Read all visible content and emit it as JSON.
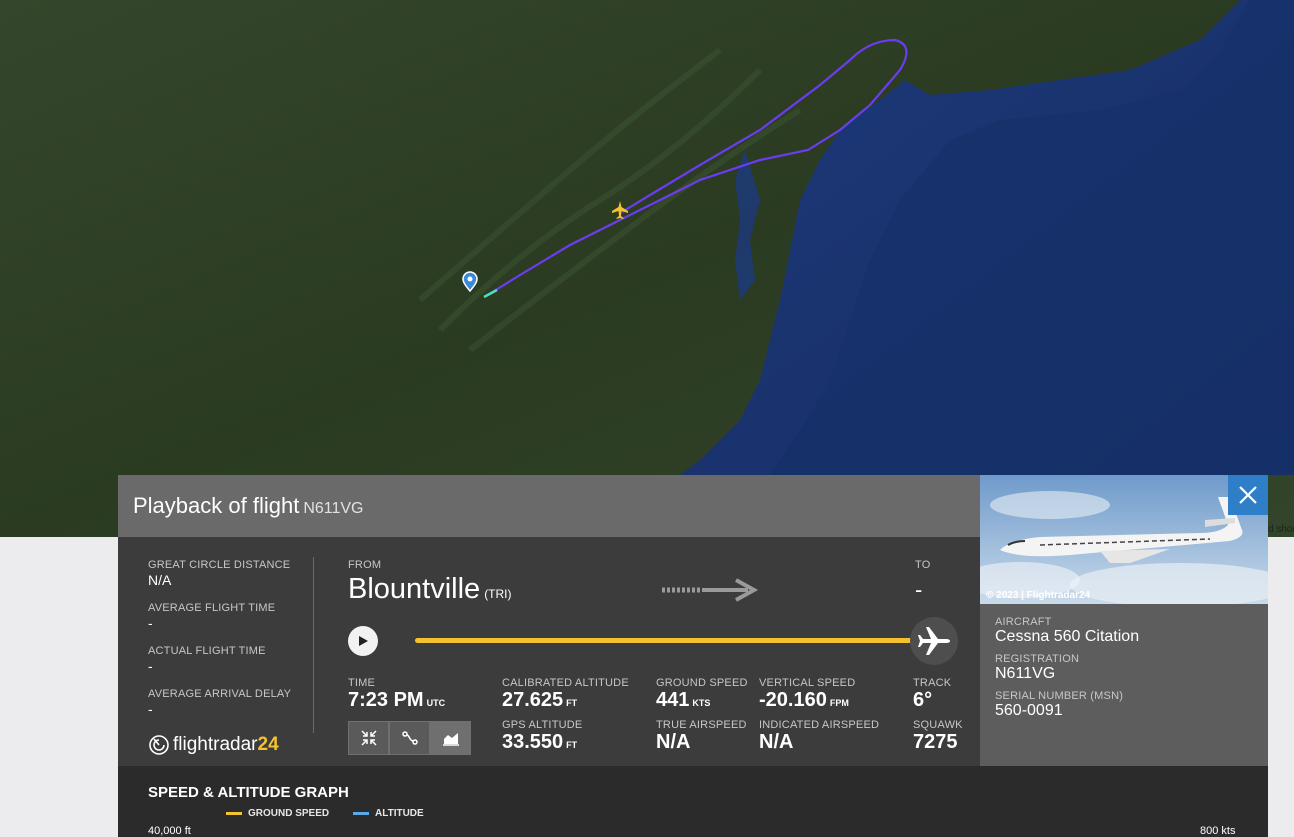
{
  "map": {
    "attribution": "d shor",
    "colors": {
      "flight_path": "#6b3cf0",
      "ocean": "#1e3d7c",
      "land": "#2d3f22",
      "aircraft": "#f3c22e",
      "origin_marker": "#3b8ad8"
    }
  },
  "panel": {
    "title": "Playback of flight",
    "registration": "N611VG",
    "close_icon": "close-icon"
  },
  "stats_left": {
    "great_circle_distance_label": "GREAT CIRCLE DISTANCE",
    "great_circle_distance": "N/A",
    "average_flight_time_label": "AVERAGE FLIGHT TIME",
    "average_flight_time": "-",
    "actual_flight_time_label": "ACTUAL FLIGHT TIME",
    "actual_flight_time": "-",
    "average_arrival_delay_label": "AVERAGE ARRIVAL DELAY",
    "average_arrival_delay": "-"
  },
  "route": {
    "from_label": "FROM",
    "from_city": "Blountville",
    "from_code": "(TRI)",
    "to_label": "TO",
    "to_value": "-"
  },
  "playback": {
    "progress": 1.0
  },
  "telemetry": {
    "time_label": "TIME",
    "time": "7:23 PM",
    "time_unit": "UTC",
    "cal_alt_label": "CALIBRATED ALTITUDE",
    "cal_alt": "27.625",
    "cal_alt_unit": "FT",
    "gps_alt_label": "GPS ALTITUDE",
    "gps_alt": "33.550",
    "gps_alt_unit": "FT",
    "ground_speed_label": "GROUND SPEED",
    "ground_speed": "441",
    "ground_speed_unit": "KTS",
    "true_airspeed_label": "TRUE AIRSPEED",
    "true_airspeed": "N/A",
    "vertical_speed_label": "VERTICAL SPEED",
    "vertical_speed": "-20.160",
    "vertical_speed_unit": "FPM",
    "indicated_airspeed_label": "INDICATED AIRSPEED",
    "indicated_airspeed": "N/A",
    "track_label": "TRACK",
    "track": "6°",
    "squawk_label": "SQUAWK",
    "squawk": "7275"
  },
  "view_buttons": [
    "collapse-icon",
    "route-icon",
    "graph-icon"
  ],
  "logo": {
    "text": "flightradar",
    "num": "24"
  },
  "aircraft": {
    "photo_credit": "© 2023 | Flightradar24",
    "aircraft_label": "AIRCRAFT",
    "aircraft": "Cessna 560 Citation",
    "registration_label": "REGISTRATION",
    "registration": "N611VG",
    "serial_label": "SERIAL NUMBER (MSN)",
    "serial": "560-0091"
  },
  "graph": {
    "title": "SPEED & ALTITUDE GRAPH",
    "legend": [
      {
        "name": "GROUND SPEED",
        "color": "#f3c22e"
      },
      {
        "name": "ALTITUDE",
        "color": "#5aa8e6"
      }
    ],
    "left_axis_top": "40,000 ft",
    "right_axis_top": "800 kts"
  }
}
